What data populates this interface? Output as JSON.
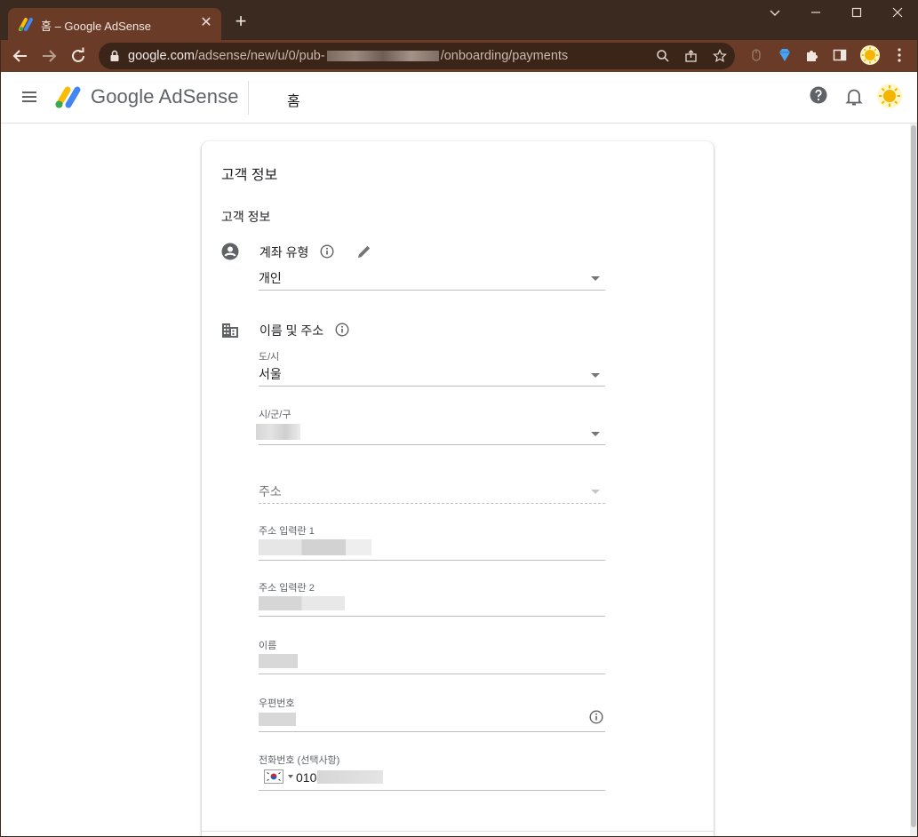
{
  "browser": {
    "tab_title": "홈 – Google AdSense",
    "new_tab": "+",
    "url_host": "google.com",
    "url_path_start": "/adsense/new/u/0/pub-",
    "url_path_end": "/onboarding/payments"
  },
  "header": {
    "logo_text": "Google AdSense",
    "page_title": "홈"
  },
  "card": {
    "title": "고객 정보",
    "section_title": "고객 정보",
    "account_type": {
      "label": "계좌 유형",
      "value": "개인"
    },
    "name_address": {
      "label": "이름 및 주소",
      "province_label": "도/시",
      "province_value": "서울",
      "city_label": "시/군/구",
      "address_placeholder": "주소",
      "address1_label": "주소 입력란 1",
      "address2_label": "주소 입력란 2",
      "name_label": "이름",
      "postal_label": "우편번호",
      "phone_label": "전화번호 (선택사항)",
      "phone_prefix": "010"
    }
  },
  "colors": {
    "tabstrip": "#3a2a1f",
    "toolbar": "#6a3c28",
    "omnibox": "#3b2418"
  }
}
